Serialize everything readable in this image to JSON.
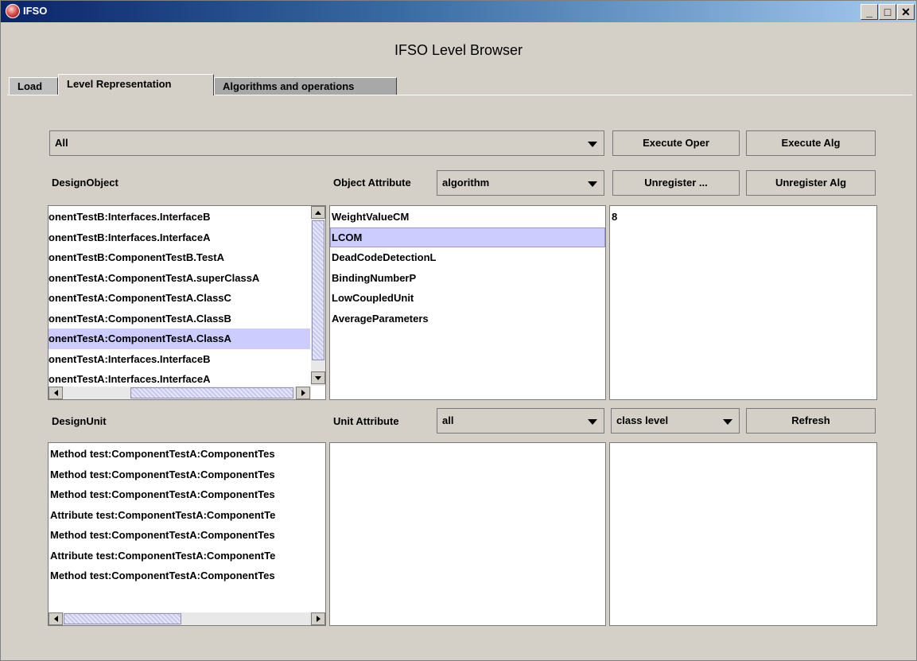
{
  "window": {
    "title": "IFSO",
    "heading": "IFSO Level Browser"
  },
  "tabs": [
    "Load",
    "Level Representation",
    "Algorithms and operations"
  ],
  "filter_combo": {
    "value": "All"
  },
  "buttons": {
    "execute_oper": "Execute Oper",
    "execute_alg": "Execute Alg",
    "unregister_oper": "Unregister ...",
    "unregister_alg": "Unregister Alg",
    "refresh": "Refresh"
  },
  "design_object": {
    "label": "DesignObject",
    "items": [
      "onentTestB:Interfaces.InterfaceB",
      "onentTestB:Interfaces.InterfaceA",
      "onentTestB:ComponentTestB.TestA",
      "onentTestA:ComponentTestA.superClassA",
      "onentTestA:ComponentTestA.ClassC",
      "onentTestA:ComponentTestA.ClassB",
      "onentTestA:ComponentTestA.ClassA",
      "onentTestA:Interfaces.InterfaceB",
      "onentTestA:Interfaces.InterfaceA"
    ],
    "selected_index": 6
  },
  "object_attribute": {
    "label": "Object Attribute",
    "combo_value": "algorithm",
    "items": [
      "WeightValueCM",
      "LCOM",
      "DeadCodeDetectionL",
      "BindingNumberP",
      "LowCoupledUnit",
      "AverageParameters"
    ],
    "selected_index": 1
  },
  "value_panel": {
    "value": "8"
  },
  "design_unit": {
    "label": "DesignUnit",
    "items": [
      "Method test:ComponentTestA:ComponentTes",
      "Method test:ComponentTestA:ComponentTes",
      "Method test:ComponentTestA:ComponentTes",
      "Attribute test:ComponentTestA:ComponentTe",
      "Method test:ComponentTestA:ComponentTes",
      "Attribute test:ComponentTestA:ComponentTe",
      "Method test:ComponentTestA:ComponentTes"
    ]
  },
  "unit_attribute": {
    "label": "Unit Attribute",
    "combo_value": "all"
  },
  "level_combo": {
    "value": "class level"
  }
}
